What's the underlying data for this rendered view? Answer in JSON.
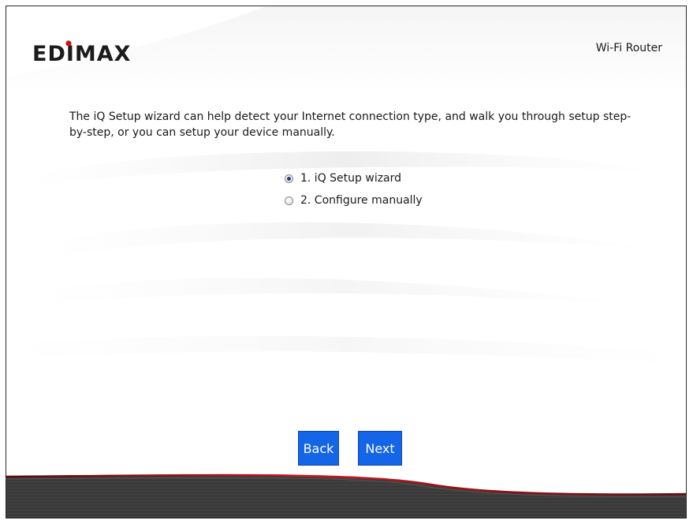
{
  "header": {
    "brand_logo_text": "EDIMAX",
    "product_name": "Wi-Fi Router"
  },
  "main": {
    "intro_text": "The iQ Setup wizard can help detect your Internet connection type, and walk you through setup step-by-step, or you can setup your device manually.",
    "options": [
      {
        "label": "1. iQ Setup wizard",
        "selected": true
      },
      {
        "label": "2. Configure manually",
        "selected": false
      }
    ]
  },
  "footer": {
    "back_label": "Back",
    "next_label": "Next"
  },
  "colors": {
    "button_blue": "#1565e8",
    "footer_dark": "#3a3a3a",
    "accent_red": "#c0101a"
  }
}
